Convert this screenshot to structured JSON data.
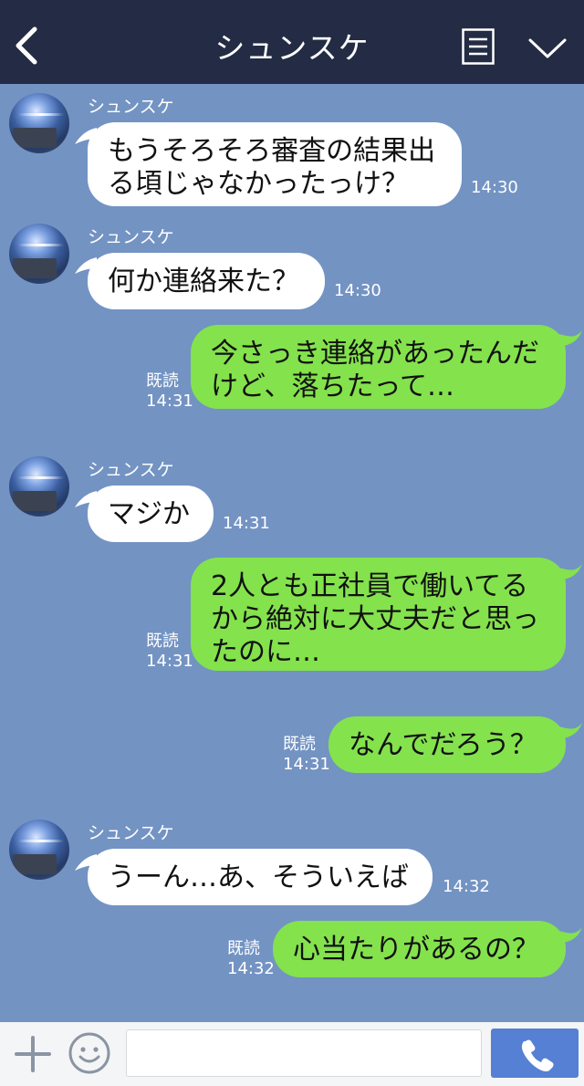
{
  "header": {
    "title": "シュンスケ",
    "back_icon": "chevron-left-icon",
    "menu_icon": "menu-list-icon",
    "collapse_icon": "chevron-down-icon",
    "background": "#232c44"
  },
  "chat": {
    "background": "#7393c3",
    "incoming_bubble_color": "#ffffff",
    "outgoing_bubble_color": "#84e24d",
    "messages": [
      {
        "direction": "in",
        "sender": "シュンスケ",
        "lines": [
          "もうそろそろ審査の結果出",
          "る頃じゃなかったっけ？"
        ],
        "time": "14:30"
      },
      {
        "direction": "in",
        "sender": "シュンスケ",
        "lines": [
          "何か連絡来た？"
        ],
        "time": "14:30"
      },
      {
        "direction": "out",
        "read": "既読",
        "lines": [
          "今さっき連絡があったんだ",
          "けど、落ちたって…"
        ],
        "time": "14:31"
      },
      {
        "direction": "in",
        "sender": "シュンスケ",
        "lines": [
          "マジか"
        ],
        "time": "14:31"
      },
      {
        "direction": "out",
        "read": "既読",
        "lines": [
          "2人とも正社員で働いてる",
          "から絶対に大丈夫だと思っ",
          "たのに…"
        ],
        "time": "14:31"
      },
      {
        "direction": "out",
        "read": "既読",
        "lines": [
          "なんでだろう？"
        ],
        "time": "14:31"
      },
      {
        "direction": "in",
        "sender": "シュンスケ",
        "lines": [
          "うーん…あ、そういえば"
        ],
        "time": "14:32"
      },
      {
        "direction": "out",
        "read": "既読",
        "lines": [
          "心当たりがあるの？"
        ],
        "time": "14:32"
      }
    ]
  },
  "footer": {
    "plus_icon": "plus-icon",
    "emoji_icon": "smiley-icon",
    "input_value": "",
    "send_icon": "phone-icon",
    "send_color": "#5580d4"
  }
}
